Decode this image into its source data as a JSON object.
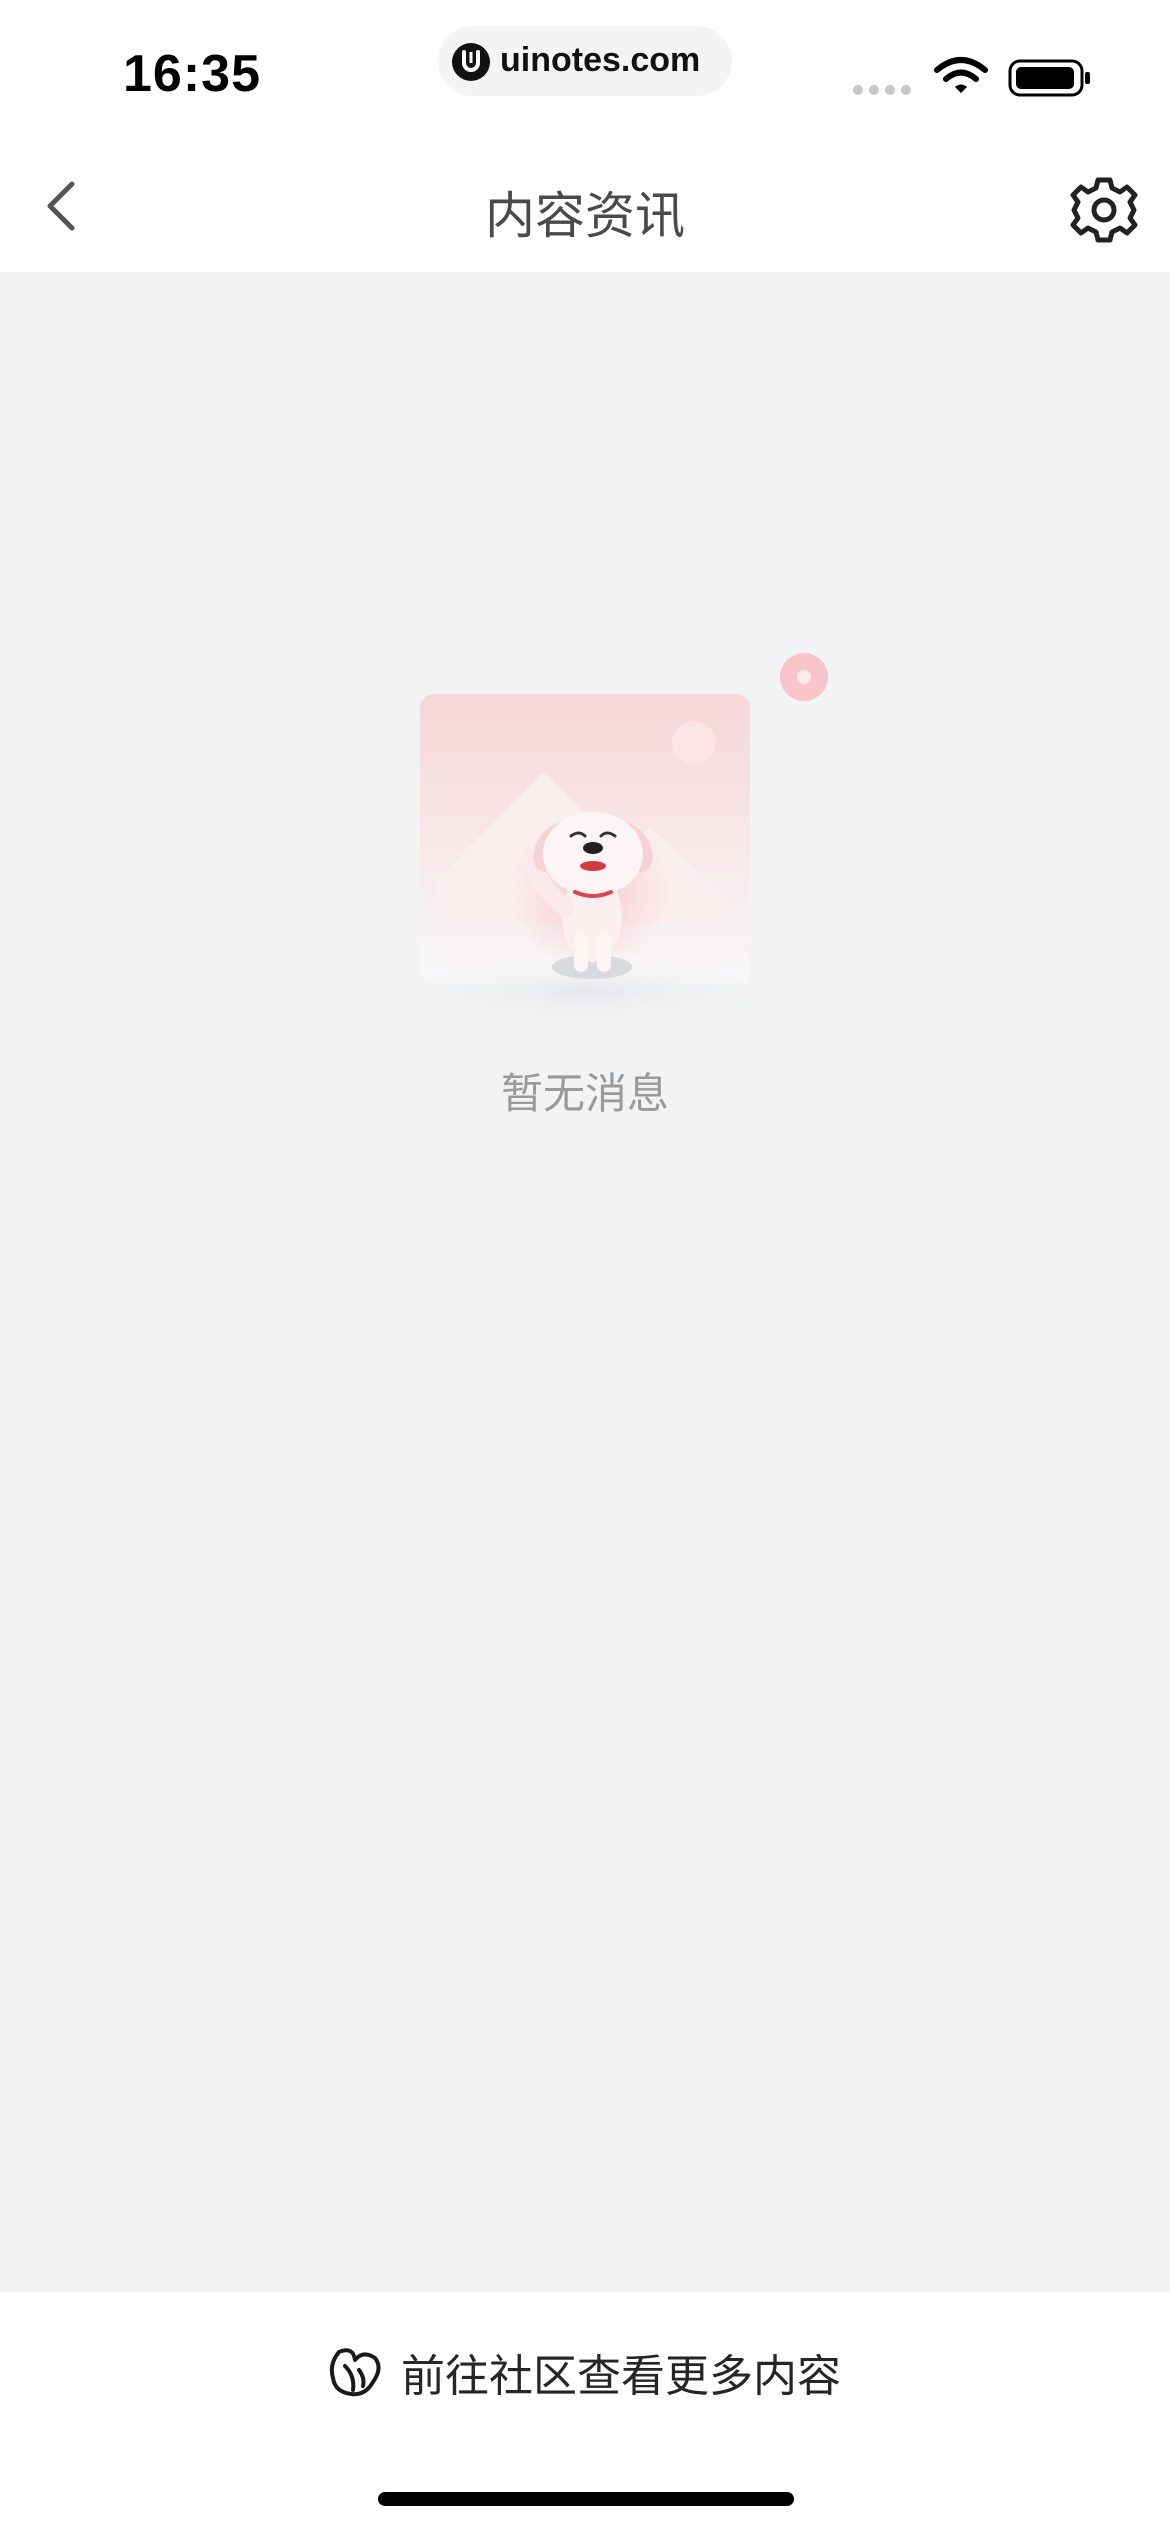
{
  "status_bar": {
    "time": "16:35",
    "url": "uinotes.com"
  },
  "header": {
    "title": "内容资讯",
    "back_icon": "chevron-left-icon",
    "settings_icon": "gear-icon"
  },
  "empty_state": {
    "message": "暂无消息",
    "illustration": "dog-mascot-empty-illustration"
  },
  "footer": {
    "community_link_label": "前往社区查看更多内容",
    "community_icon": "community-leaf-icon"
  },
  "colors": {
    "background": "#f2f3f5",
    "title_text": "#4a4a4a",
    "empty_text": "#9a9a9a",
    "link_text": "#262626",
    "accent_pink": "#f5b8bf"
  }
}
